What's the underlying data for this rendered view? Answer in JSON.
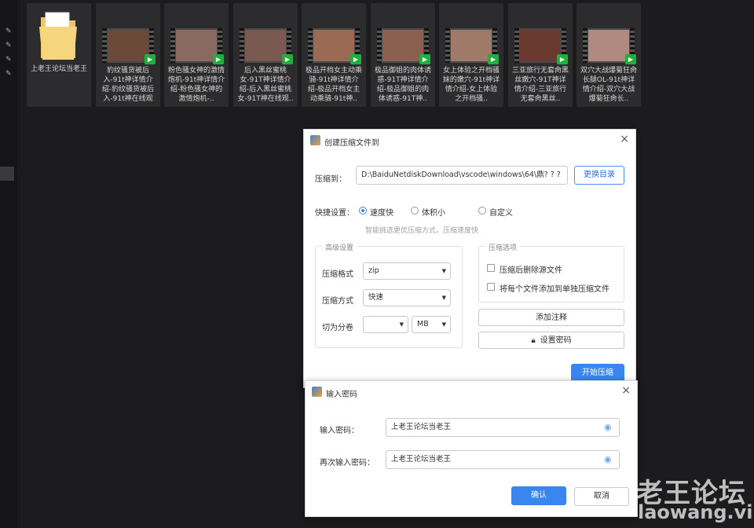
{
  "files": [
    {
      "label": "上老王论坛当老王",
      "type": "folder"
    },
    {
      "label": "豹纹骚货被后入-91t神详情介绍-豹纹骚货被后入-91t神在线观看..",
      "type": "video",
      "tint": "#6b4a3a"
    },
    {
      "label": "粉色骚女神的激情炮机-91t神详情介绍-粉色骚女神的激情炮机-..",
      "type": "video",
      "tint": "#8a6a60"
    },
    {
      "label": "后入黑丝蜜桃女-91T神详情介绍-后入黑丝蜜桃女-91T神在线观..",
      "type": "video",
      "tint": "#7a5a50"
    },
    {
      "label": "极品开档女主动乘骑-91t神详情介绍-极品开档女主动乘骑-91t神..",
      "type": "video",
      "tint": "#9a6a55"
    },
    {
      "label": "极品御姐的肉体诱惑-91T神详情介绍-极品御姐的肉体诱惑-91T神..",
      "type": "video",
      "tint": "#8a6050"
    },
    {
      "label": "女上体验之开档骚妹的嫩穴-91t神详情介绍-女上体验之开档骚..",
      "type": "video",
      "tint": "#a07a68"
    },
    {
      "label": "三亚旅行无套肏黑丝嫩穴-91T神详情介绍-三亚旅行无套肏黑丝..",
      "type": "video",
      "tint": "#6a3a30"
    },
    {
      "label": "双穴大战爆菊狂肏长腿OL-91t神详情介绍-双穴大战爆菊狂肏长..",
      "type": "video",
      "tint": "#b08a80"
    }
  ],
  "compress_dialog": {
    "title": "创建压缩文件到",
    "close": "×",
    "path_label": "压缩到：",
    "path_value": "D:\\BaiduNetdiskDownload\\vscode\\windows\\64\\鼎? ? ?",
    "change_dir": "更换目录",
    "quick_label": "快捷设置：",
    "options": [
      "速度快",
      "体积小",
      "自定义"
    ],
    "selected_option": "速度快",
    "hint": "智能挑选更优压缩方式，压缩速度快",
    "advanced_title": "高级设置",
    "format_label": "压缩格式",
    "format_value": "zip",
    "method_label": "压缩方式",
    "method_value": "快速",
    "split_label": "切为分卷",
    "split_value": "",
    "split_unit": "MB",
    "compress_opts_title": "压缩选项",
    "delete_after": "压缩后删除源文件",
    "each_separate": "将每个文件添加到单独压缩文件",
    "add_comment": "添加注释",
    "set_password": "设置密码",
    "start": "开始压缩"
  },
  "password_dialog": {
    "title": "输入密码",
    "close": "×",
    "enter_label": "输入密码：",
    "enter_value": "上老王论坛当老王",
    "repeat_label": "再次输入密码：",
    "repeat_value": "上老王论坛当老王",
    "confirm": "确认",
    "cancel": "取消"
  },
  "watermark": {
    "line1": "老王论坛",
    "line2": "laowang.vip"
  },
  "colors": {
    "accent": "#3a86f0",
    "play": "#1db03a",
    "bg": "#1c1c1e"
  }
}
